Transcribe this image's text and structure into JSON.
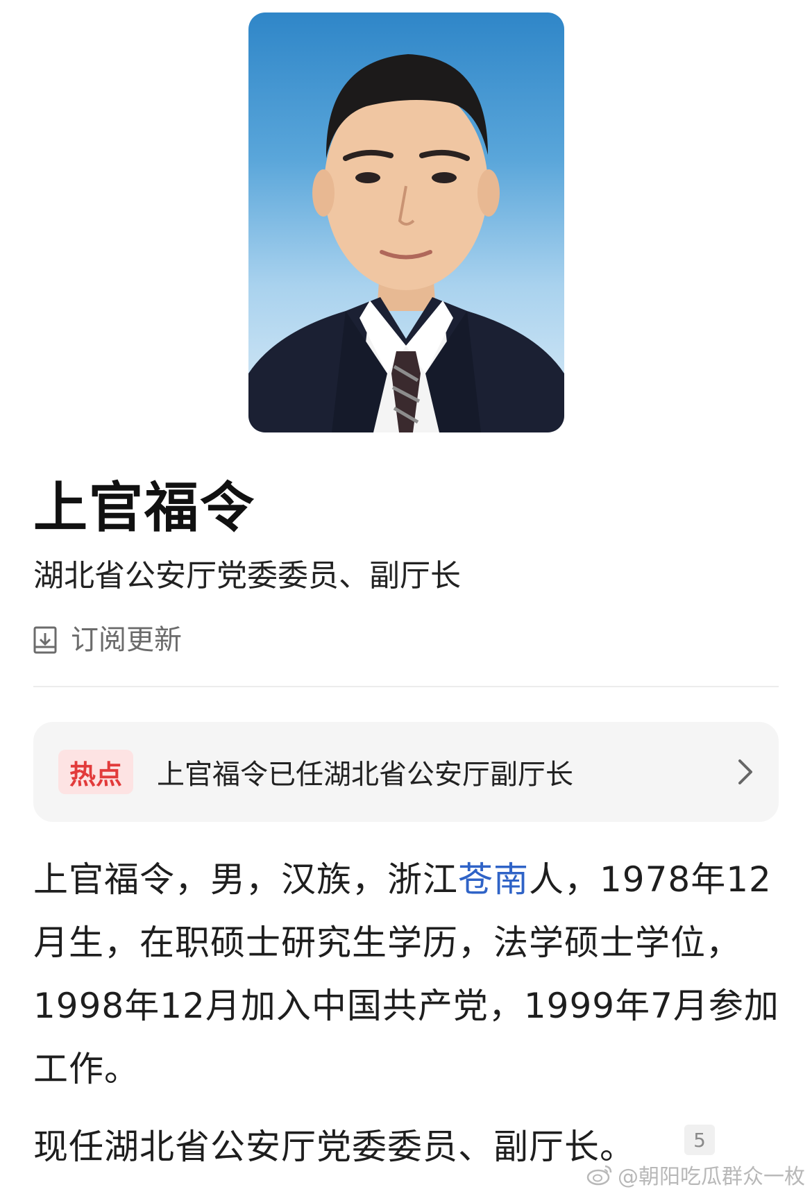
{
  "profile": {
    "name": "上官福令",
    "title": "湖北省公安厅党委委员、副厅长",
    "subscribe_label": "订阅更新",
    "photo_icon": "portrait-photo"
  },
  "hot": {
    "badge": "热点",
    "text": "上官福令已任湖北省公安厅副厅长",
    "chevron_icon": "chevron-right-icon"
  },
  "bio": {
    "part1": "上官福令，男，汉族，浙江",
    "link": "苍南",
    "part2": "人，1978年12月生，在职硕士研究生学历，法学硕士学位，1998年12月加入中国共产党，1999年7月参加工作。"
  },
  "current": {
    "text": "现任湖北省公安厅党委委员、副厅长。",
    "citation": "5"
  },
  "watermark": {
    "text": "@朝阳吃瓜群众一枚",
    "icon": "weibo-icon"
  },
  "colors": {
    "link": "#2f63c7",
    "badge_bg": "#fde3e3",
    "badge_text": "#e23b3b",
    "card_bg": "#f5f5f5"
  }
}
